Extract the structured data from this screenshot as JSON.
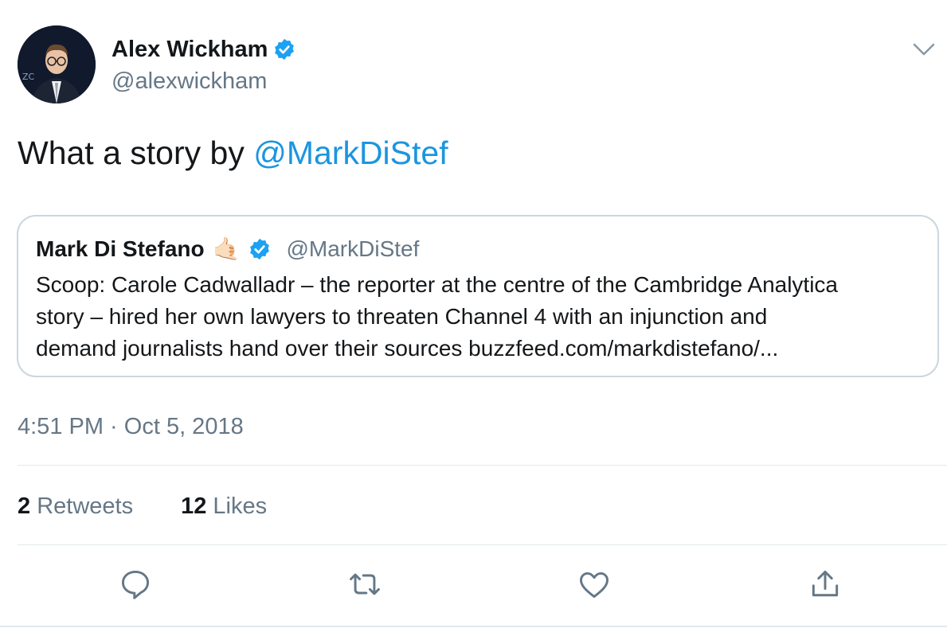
{
  "author": {
    "name": "Alex Wickham",
    "handle": "@alexwickham",
    "verified": true
  },
  "tweet": {
    "text_prefix": "What a story by ",
    "mention": "@MarkDiStef"
  },
  "quoted_tweet": {
    "name": "Mark Di Stefano",
    "emoji": "🤙🏻",
    "verified": true,
    "handle": "@MarkDiStef",
    "text_line1": "Scoop: Carole Cadwalladr – the reporter at the centre of the Cambridge Analytica",
    "text_line2": "story –  hired her own lawyers to threaten Channel 4 with an injunction and",
    "text_line3": "demand journalists hand over their sources  buzzfeed.com/markdistefano/..."
  },
  "timestamp": "4:51 PM · Oct 5, 2018",
  "stats": {
    "retweets_count": "2",
    "retweets_label": "Retweets",
    "likes_count": "12",
    "likes_label": "Likes"
  },
  "actions": [
    "reply-icon",
    "retweet-icon",
    "like-icon",
    "share-icon"
  ],
  "colors": {
    "text": "#14171a",
    "secondary": "#657786",
    "link": "#1b95e0",
    "verified": "#1da1f2",
    "border": "#ccd6dd"
  }
}
